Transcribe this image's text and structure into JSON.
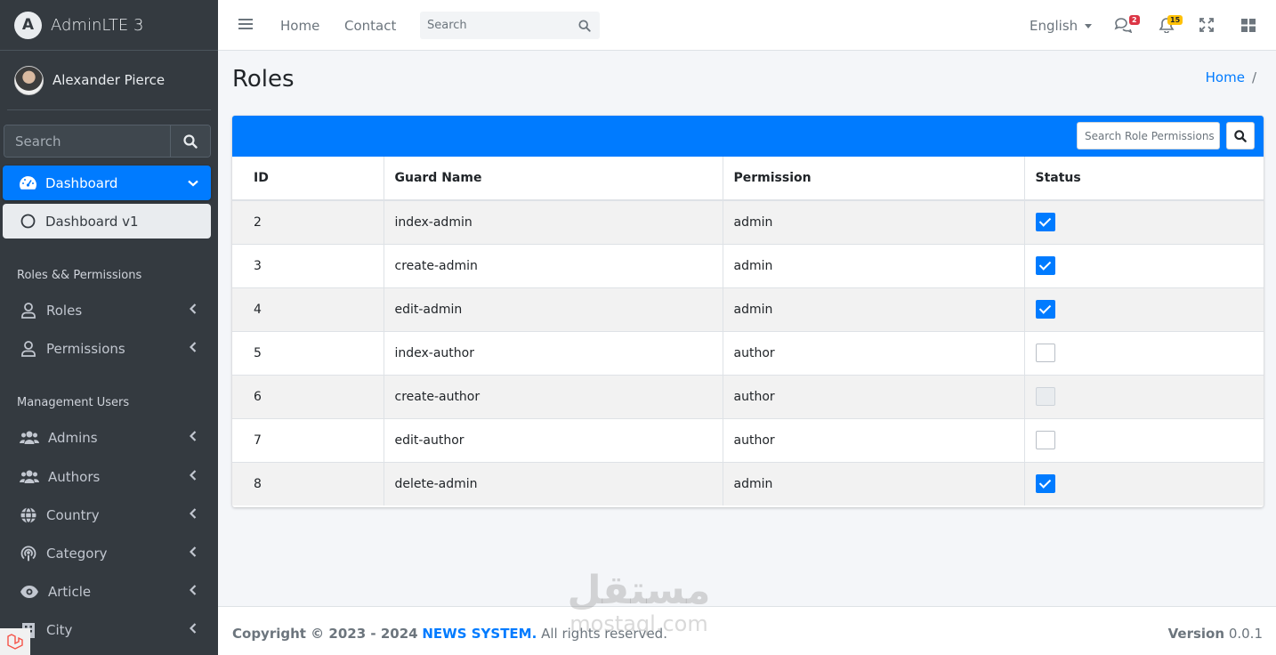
{
  "brand": {
    "logo_letter": "A",
    "title": "AdminLTE 3"
  },
  "user": {
    "name": "Alexander Pierce"
  },
  "sidebar": {
    "search_placeholder": "Search",
    "active_item": "Dashboard",
    "sub_item": "Dashboard v1",
    "headers": [
      "Roles && Permissions",
      "Management Users"
    ],
    "items": [
      {
        "label": "Roles",
        "icon": "user-icon"
      },
      {
        "label": "Permissions",
        "icon": "user-icon"
      },
      {
        "label": "Admins",
        "icon": "users-icon"
      },
      {
        "label": "Authors",
        "icon": "users-icon"
      },
      {
        "label": "Country",
        "icon": "globe-icon"
      },
      {
        "label": "Category",
        "icon": "podcast-icon"
      },
      {
        "label": "Article",
        "icon": "eye-icon"
      },
      {
        "label": "City",
        "icon": "building-icon"
      }
    ]
  },
  "topnav": {
    "links": [
      "Home",
      "Contact"
    ],
    "search_placeholder": "Search",
    "language": "English",
    "messages_badge": "2",
    "notifications_badge": "15"
  },
  "page": {
    "title": "Roles",
    "breadcrumb": [
      "Home",
      "/"
    ]
  },
  "card": {
    "search_placeholder": "Search Role Permissions",
    "columns": [
      "ID",
      "Guard Name",
      "Permission",
      "Status"
    ],
    "rows": [
      {
        "id": "2",
        "guard": "index-admin",
        "permission": "admin",
        "status": "checked"
      },
      {
        "id": "3",
        "guard": "create-admin",
        "permission": "admin",
        "status": "checked"
      },
      {
        "id": "4",
        "guard": "edit-admin",
        "permission": "admin",
        "status": "checked"
      },
      {
        "id": "5",
        "guard": "index-author",
        "permission": "author",
        "status": "unchecked"
      },
      {
        "id": "6",
        "guard": "create-author",
        "permission": "author",
        "status": "disabled"
      },
      {
        "id": "7",
        "guard": "edit-author",
        "permission": "author",
        "status": "unchecked"
      },
      {
        "id": "8",
        "guard": "delete-admin",
        "permission": "admin",
        "status": "checked"
      }
    ]
  },
  "footer": {
    "copyright": "Copyright © 2023 - 2024",
    "site": "NEWS SYSTEM.",
    "rights": "All rights reserved.",
    "version_label": "Version",
    "version": "0.0.1"
  },
  "watermark": {
    "arabic": "مستقل",
    "latin": "mostaql.com"
  },
  "colors": {
    "primary": "#007bff",
    "sidebar": "#343a40",
    "background": "#f4f6f9"
  }
}
